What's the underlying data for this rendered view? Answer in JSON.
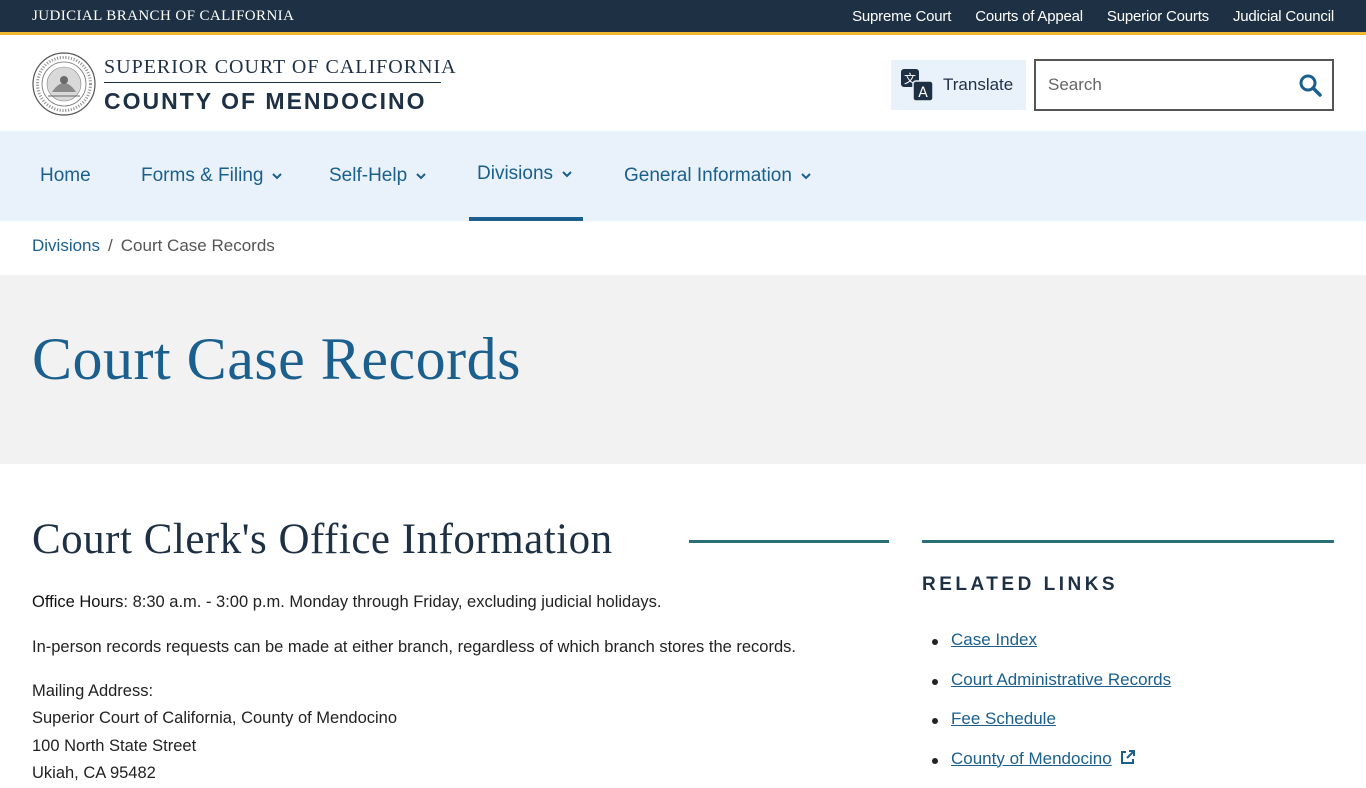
{
  "utility": {
    "brand": "JUDICIAL BRANCH OF CALIFORNIA",
    "links": [
      "Supreme Court",
      "Courts of Appeal",
      "Superior Courts",
      "Judicial Council"
    ]
  },
  "header": {
    "logo_line1": "SUPERIOR COURT OF CALIFORNIA",
    "logo_line2": "COUNTY OF MENDOCINO",
    "translate_label": "Translate",
    "search_placeholder": "Search"
  },
  "nav": {
    "items": [
      {
        "label": "Home"
      },
      {
        "label": "Forms & Filing"
      },
      {
        "label": "Self-Help"
      },
      {
        "label": "Divisions"
      },
      {
        "label": "General Information"
      }
    ]
  },
  "breadcrumb": {
    "parent": "Divisions",
    "separator": "/",
    "current": "Court Case Records"
  },
  "hero": {
    "title": "Court Case Records"
  },
  "content": {
    "heading": "Court Clerk's Office Information",
    "office_hours_label": "Office Hours",
    "office_hours_text": ": 8:30 a.m. - 3:00 p.m. Monday through Friday, excluding judicial holidays.",
    "inperson_text": "In-person records requests can be made at either branch, regardless of which branch stores the records.",
    "mailing_label": "Mailing Address:",
    "mailing_line1": "Superior Court of California, County of Mendocino",
    "mailing_line2": "100 North State Street",
    "mailing_line3": "Ukiah, CA 95482"
  },
  "sidebar": {
    "title": "RELATED LINKS",
    "links": [
      "Case Index",
      "Court Administrative Records",
      "Fee Schedule",
      "County of Mendocino"
    ]
  },
  "colors": {
    "utility_bg": "#1e3044",
    "accent_gold": "#f0b731",
    "link_blue": "#1a5f8e",
    "nav_bg": "#e9f2fa",
    "rule_teal": "#2a6f78"
  }
}
